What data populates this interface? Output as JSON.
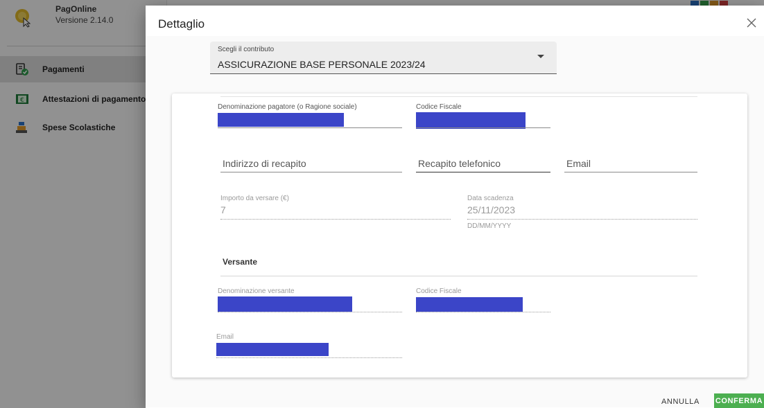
{
  "app": {
    "name": "PagOnline",
    "version": "Versione 2.14.0"
  },
  "sidebar": {
    "items": [
      {
        "label": "Pagamenti",
        "icon": "payments-icon",
        "active": true
      },
      {
        "label": "Attestazioni di pagamento",
        "icon": "receipt-icon",
        "active": false
      },
      {
        "label": "Spese Scolastiche",
        "icon": "cash-register-icon",
        "active": false
      }
    ]
  },
  "dialog": {
    "title": "Dettaglio",
    "close_icon": "close-icon",
    "select": {
      "label": "Scegli il contributo",
      "value": "ASSICURAZIONE BASE PERSONALE 2023/24"
    },
    "payer": {
      "name_label": "Denominazione pagatore (o Ragione sociale)",
      "tax_code_label": "Codice Fiscale",
      "address_placeholder": "Indirizzo di recapito",
      "phone_placeholder": "Recapito telefonico",
      "email_placeholder": "Email"
    },
    "payment": {
      "amount_label": "Importo da versare (€)",
      "amount_value": "7",
      "due_date_label": "Data scadenza",
      "due_date_value": "25/11/2023",
      "due_date_hint": "DD/MM/YYYY"
    },
    "versante": {
      "title": "Versante",
      "name_label": "Denominazione versante",
      "tax_code_label": "Codice Fiscale",
      "email_label": "Email"
    },
    "buttons": {
      "cancel": "ANNULLA",
      "confirm": "CONFERMA"
    }
  },
  "colors": {
    "redaction": "#3b45c8",
    "confirm": "#4caf50",
    "overlay": "rgba(0,0,0,0.42)"
  }
}
